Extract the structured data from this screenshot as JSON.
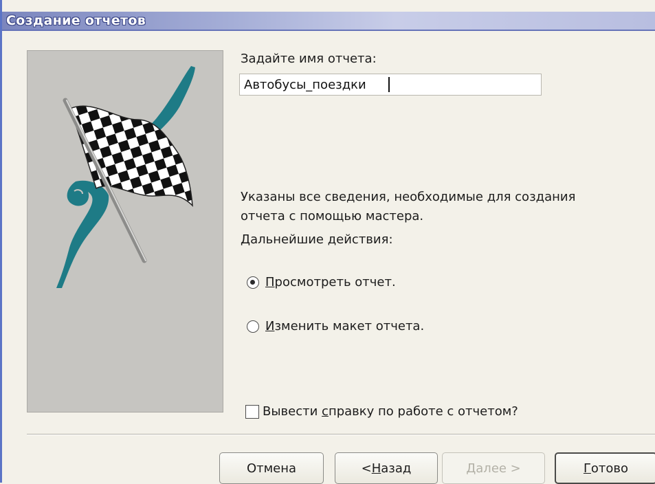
{
  "window": {
    "title": "Создание отчетов"
  },
  "form": {
    "name_label": "Задайте имя отчета:",
    "name_value": "Автобусы_поездки",
    "info_line1": "Указаны все сведения, необходимые для создания",
    "info_line2": "отчета с помощью мастера.",
    "next_actions_label": "Дальнейшие действия:",
    "options": [
      {
        "mnemonic": "П",
        "rest": "росмотреть отчет.",
        "checked": true
      },
      {
        "mnemonic": "И",
        "rest": "зменить макет отчета.",
        "checked": false
      }
    ],
    "help_checkbox": {
      "before": "Вывести ",
      "mnemonic": "с",
      "after": "правку по работе с отчетом?",
      "checked": false
    }
  },
  "buttons": {
    "cancel": "Отмена",
    "back_prefix": "< ",
    "back_mnemonic": "Н",
    "back_rest": "азад",
    "next": "Далее >",
    "finish_mnemonic": "Г",
    "finish_rest": "отово"
  },
  "image": {
    "icon": "checkered-flag-icon",
    "accent": "#1e7b86"
  }
}
